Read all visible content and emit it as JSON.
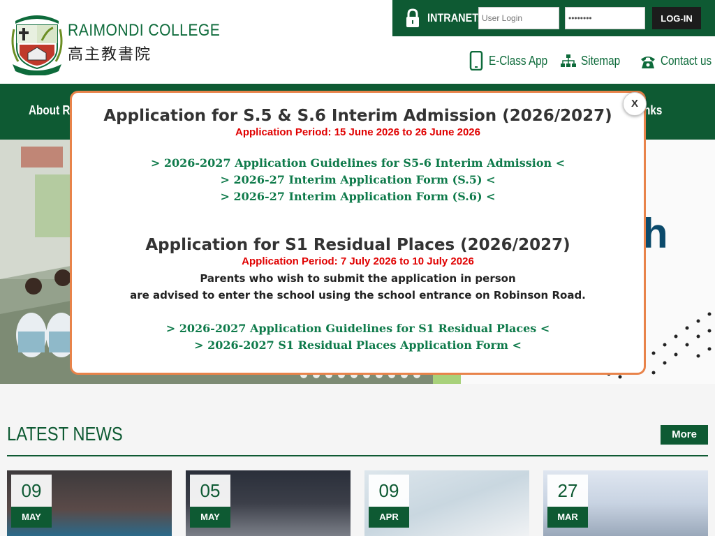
{
  "header": {
    "logo_en": "RAIMONDI COLLEGE",
    "logo_zh": "高主教書院",
    "intranet_label": "INTRANET:",
    "user_placeholder": "User Login",
    "pass_value": "••••••••",
    "login_label": "LOG-IN",
    "quick_links": [
      {
        "label": "E-Class App",
        "icon": "phone-icon"
      },
      {
        "label": "Sitemap",
        "icon": "sitemap-icon"
      },
      {
        "label": "Contact us",
        "icon": "telephone-icon"
      }
    ]
  },
  "nav": {
    "about": "About Ra",
    "links": "nks"
  },
  "banner": {
    "graphic_text": "h"
  },
  "news": {
    "title": "LATEST NEWS",
    "more_label": "More",
    "items": [
      {
        "day": "09",
        "month": "MAY"
      },
      {
        "day": "05",
        "month": "MAY"
      },
      {
        "day": "09",
        "month": "APR"
      },
      {
        "day": "27",
        "month": "MAR"
      }
    ]
  },
  "modal": {
    "close_label": "X",
    "section1": {
      "heading": "Application for S.5 & S.6 Interim Admission (2026/2027)",
      "period": "Application Period: 15 June 2026 to 26 June 2026",
      "links": [
        "> 2026-2027 Application Guidelines for S5-6 Interim Admission <",
        "> 2026-27 Interim Application Form (S.5) <",
        "> 2026-27 Interim Application Form (S.6) <"
      ]
    },
    "section2": {
      "heading": "Application for S1 Residual Places (2026/2027)",
      "period": "Application Period: 7 July 2026 to 10 July 2026",
      "note_line1": "Parents who wish to submit the application in person",
      "note_line2": "are advised to enter the school using the school entrance on Robinson Road.",
      "links": [
        "> 2026-2027 Application Guidelines for S1 Residual Places <",
        "> 2026-2027 S1 Residual Places Application Form <"
      ]
    }
  },
  "colors": {
    "brand_green": "#0e5a33",
    "link_green": "#0e7a4a",
    "period_red": "#e00000",
    "modal_border": "#e8834a"
  }
}
